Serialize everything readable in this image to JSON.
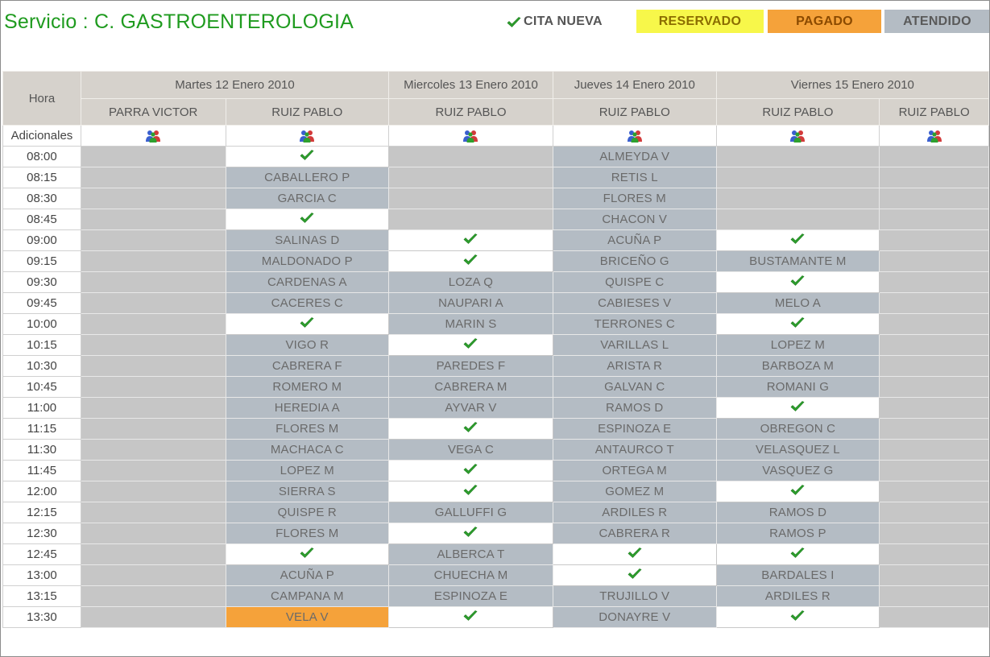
{
  "header": {
    "title": "Servicio : C. GASTROENTEROLOGIA"
  },
  "legend": {
    "new_label": "CITA NUEVA",
    "reserved_label": "RESERVADO",
    "paid_label": "PAGADO",
    "attended_label": "ATENDIDO",
    "colors": {
      "reserved": "#f7f74a",
      "paid": "#f5a23a",
      "attended": "#b4bcc4",
      "blocked": "#c6c6c6",
      "available": "#ffffff"
    }
  },
  "grid": {
    "hour_header": "Hora",
    "additional_label": "Adicionales",
    "days": [
      {
        "label": "Martes 12 Enero 2010",
        "span": 2
      },
      {
        "label": "Miercoles 13 Enero 2010",
        "span": 1
      },
      {
        "label": "Jueves 14 Enero 2010",
        "span": 1
      },
      {
        "label": "Viernes 15 Enero 2010",
        "span": 2
      }
    ],
    "doctors": [
      "PARRA VICTOR",
      "RUIZ PABLO",
      "RUIZ PABLO",
      "RUIZ PABLO",
      "RUIZ PABLO",
      "RUIZ PABLO"
    ],
    "additional_icon": "people-group-icon",
    "rows": [
      {
        "time": "08:00",
        "cells": [
          {
            "s": "blocked"
          },
          {
            "s": "available"
          },
          {
            "s": "blocked"
          },
          {
            "s": "attended",
            "name": "ALMEYDA V"
          },
          {
            "s": "blocked"
          },
          {
            "s": "blocked"
          }
        ]
      },
      {
        "time": "08:15",
        "cells": [
          {
            "s": "blocked"
          },
          {
            "s": "attended",
            "name": "CABALLERO P"
          },
          {
            "s": "blocked"
          },
          {
            "s": "attended",
            "name": "RETIS L"
          },
          {
            "s": "blocked"
          },
          {
            "s": "blocked"
          }
        ]
      },
      {
        "time": "08:30",
        "cells": [
          {
            "s": "blocked"
          },
          {
            "s": "attended",
            "name": "GARCIA C"
          },
          {
            "s": "blocked"
          },
          {
            "s": "attended",
            "name": "FLORES M"
          },
          {
            "s": "blocked"
          },
          {
            "s": "blocked"
          }
        ]
      },
      {
        "time": "08:45",
        "cells": [
          {
            "s": "blocked"
          },
          {
            "s": "available"
          },
          {
            "s": "blocked"
          },
          {
            "s": "attended",
            "name": "CHACON V"
          },
          {
            "s": "blocked"
          },
          {
            "s": "blocked"
          }
        ]
      },
      {
        "time": "09:00",
        "cells": [
          {
            "s": "blocked"
          },
          {
            "s": "attended",
            "name": "SALINAS D"
          },
          {
            "s": "available"
          },
          {
            "s": "attended",
            "name": "ACUÑA P"
          },
          {
            "s": "available"
          },
          {
            "s": "blocked"
          }
        ]
      },
      {
        "time": "09:15",
        "cells": [
          {
            "s": "blocked"
          },
          {
            "s": "attended",
            "name": "MALDONADO P"
          },
          {
            "s": "available"
          },
          {
            "s": "attended",
            "name": "BRICEÑO G"
          },
          {
            "s": "attended",
            "name": "BUSTAMANTE M"
          },
          {
            "s": "blocked"
          }
        ]
      },
      {
        "time": "09:30",
        "cells": [
          {
            "s": "blocked"
          },
          {
            "s": "attended",
            "name": "CARDENAS A"
          },
          {
            "s": "attended",
            "name": "LOZA Q"
          },
          {
            "s": "attended",
            "name": "QUISPE C"
          },
          {
            "s": "available"
          },
          {
            "s": "blocked"
          }
        ]
      },
      {
        "time": "09:45",
        "cells": [
          {
            "s": "blocked"
          },
          {
            "s": "attended",
            "name": "CACERES C"
          },
          {
            "s": "attended",
            "name": "NAUPARI A"
          },
          {
            "s": "attended",
            "name": "CABIESES V"
          },
          {
            "s": "attended",
            "name": "MELO A"
          },
          {
            "s": "blocked"
          }
        ]
      },
      {
        "time": "10:00",
        "cells": [
          {
            "s": "blocked"
          },
          {
            "s": "available"
          },
          {
            "s": "attended",
            "name": "MARIN S"
          },
          {
            "s": "attended",
            "name": "TERRONES C"
          },
          {
            "s": "available"
          },
          {
            "s": "blocked"
          }
        ]
      },
      {
        "time": "10:15",
        "cells": [
          {
            "s": "blocked"
          },
          {
            "s": "attended",
            "name": "VIGO R"
          },
          {
            "s": "available"
          },
          {
            "s": "attended",
            "name": "VARILLAS L"
          },
          {
            "s": "attended",
            "name": "LOPEZ M"
          },
          {
            "s": "blocked"
          }
        ]
      },
      {
        "time": "10:30",
        "cells": [
          {
            "s": "blocked"
          },
          {
            "s": "attended",
            "name": "CABRERA F"
          },
          {
            "s": "attended",
            "name": "PAREDES F"
          },
          {
            "s": "attended",
            "name": "ARISTA R"
          },
          {
            "s": "attended",
            "name": "BARBOZA M"
          },
          {
            "s": "blocked"
          }
        ]
      },
      {
        "time": "10:45",
        "cells": [
          {
            "s": "blocked"
          },
          {
            "s": "attended",
            "name": "ROMERO M"
          },
          {
            "s": "attended",
            "name": "CABRERA M"
          },
          {
            "s": "attended",
            "name": "GALVAN C"
          },
          {
            "s": "attended",
            "name": "ROMANI G"
          },
          {
            "s": "blocked"
          }
        ]
      },
      {
        "time": "11:00",
        "cells": [
          {
            "s": "blocked"
          },
          {
            "s": "attended",
            "name": "HEREDIA A"
          },
          {
            "s": "attended",
            "name": "AYVAR V"
          },
          {
            "s": "attended",
            "name": "RAMOS D"
          },
          {
            "s": "available"
          },
          {
            "s": "blocked"
          }
        ]
      },
      {
        "time": "11:15",
        "cells": [
          {
            "s": "blocked"
          },
          {
            "s": "attended",
            "name": "FLORES M"
          },
          {
            "s": "available"
          },
          {
            "s": "attended",
            "name": "ESPINOZA E"
          },
          {
            "s": "attended",
            "name": "OBREGON C"
          },
          {
            "s": "blocked"
          }
        ]
      },
      {
        "time": "11:30",
        "cells": [
          {
            "s": "blocked"
          },
          {
            "s": "attended",
            "name": "MACHACA C"
          },
          {
            "s": "attended",
            "name": "VEGA C"
          },
          {
            "s": "attended",
            "name": "ANTAURCO T"
          },
          {
            "s": "attended",
            "name": "VELASQUEZ L"
          },
          {
            "s": "blocked"
          }
        ]
      },
      {
        "time": "11:45",
        "cells": [
          {
            "s": "blocked"
          },
          {
            "s": "attended",
            "name": "LOPEZ M"
          },
          {
            "s": "available"
          },
          {
            "s": "attended",
            "name": "ORTEGA M"
          },
          {
            "s": "attended",
            "name": "VASQUEZ G"
          },
          {
            "s": "blocked"
          }
        ]
      },
      {
        "time": "12:00",
        "cells": [
          {
            "s": "blocked"
          },
          {
            "s": "attended",
            "name": "SIERRA S"
          },
          {
            "s": "available"
          },
          {
            "s": "attended",
            "name": "GOMEZ M"
          },
          {
            "s": "available"
          },
          {
            "s": "blocked"
          }
        ]
      },
      {
        "time": "12:15",
        "cells": [
          {
            "s": "blocked"
          },
          {
            "s": "attended",
            "name": "QUISPE R"
          },
          {
            "s": "attended",
            "name": "GALLUFFI G"
          },
          {
            "s": "attended",
            "name": "ARDILES R"
          },
          {
            "s": "attended",
            "name": "RAMOS D"
          },
          {
            "s": "blocked"
          }
        ]
      },
      {
        "time": "12:30",
        "cells": [
          {
            "s": "blocked"
          },
          {
            "s": "attended",
            "name": "FLORES M"
          },
          {
            "s": "available"
          },
          {
            "s": "attended",
            "name": "CABRERA R"
          },
          {
            "s": "attended",
            "name": "RAMOS P"
          },
          {
            "s": "blocked"
          }
        ]
      },
      {
        "time": "12:45",
        "cells": [
          {
            "s": "blocked"
          },
          {
            "s": "available"
          },
          {
            "s": "attended",
            "name": "ALBERCA T"
          },
          {
            "s": "available"
          },
          {
            "s": "available"
          },
          {
            "s": "blocked"
          }
        ]
      },
      {
        "time": "13:00",
        "cells": [
          {
            "s": "blocked"
          },
          {
            "s": "attended",
            "name": "ACUÑA P"
          },
          {
            "s": "attended",
            "name": "CHUECHA M"
          },
          {
            "s": "available"
          },
          {
            "s": "attended",
            "name": "BARDALES I"
          },
          {
            "s": "blocked"
          }
        ]
      },
      {
        "time": "13:15",
        "cells": [
          {
            "s": "blocked"
          },
          {
            "s": "attended",
            "name": "CAMPANA M"
          },
          {
            "s": "attended",
            "name": "ESPINOZA E"
          },
          {
            "s": "attended",
            "name": "TRUJILLO V"
          },
          {
            "s": "attended",
            "name": "ARDILES R"
          },
          {
            "s": "blocked"
          }
        ]
      },
      {
        "time": "13:30",
        "cells": [
          {
            "s": "blocked"
          },
          {
            "s": "paid",
            "name": "VELA V"
          },
          {
            "s": "available"
          },
          {
            "s": "attended",
            "name": "DONAYRE V"
          },
          {
            "s": "available"
          },
          {
            "s": "blocked"
          }
        ]
      }
    ]
  }
}
